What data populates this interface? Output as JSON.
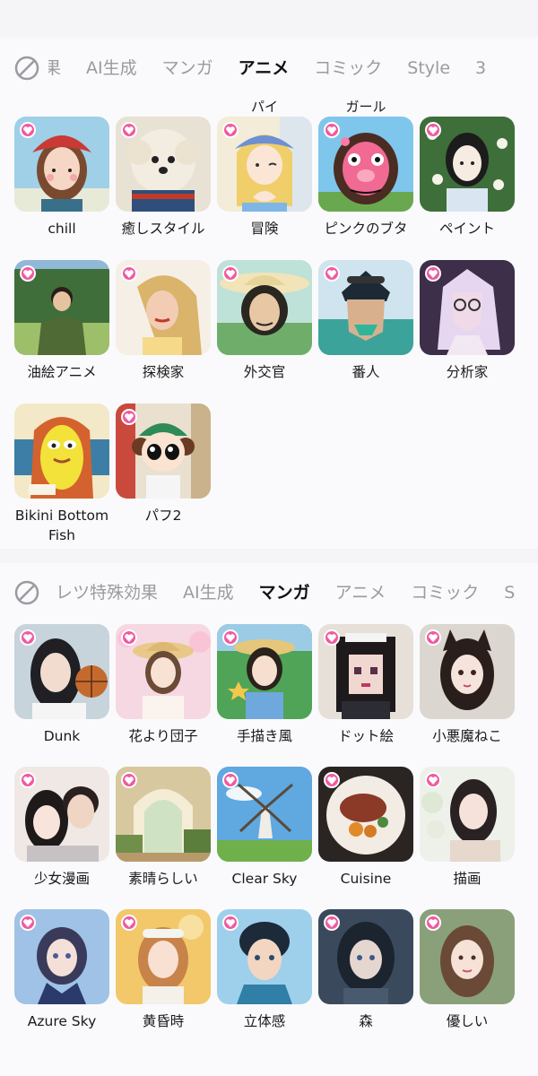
{
  "section1": {
    "tabs": [
      {
        "label": "効果",
        "active": false
      },
      {
        "label": "AI生成",
        "active": false
      },
      {
        "label": "マンガ",
        "active": false
      },
      {
        "label": "アニメ",
        "active": true
      },
      {
        "label": "コミック",
        "active": false
      },
      {
        "label": "Style",
        "active": false
      },
      {
        "label": "3",
        "active": false
      }
    ],
    "overflow_labels": [
      "パイ",
      "ガール"
    ],
    "items": [
      {
        "label": "chill",
        "icon": "girl-red-hat-portrait"
      },
      {
        "label": "癒しスタイル",
        "icon": "fluffy-dog-portrait"
      },
      {
        "label": "冒険",
        "icon": "blonde-girl-heart-hands"
      },
      {
        "label": "ピンクのブタ",
        "icon": "pink-pig-character"
      },
      {
        "label": "ペイント",
        "icon": "girl-flowers-painting"
      },
      {
        "label": "油絵アニメ",
        "icon": "man-forest-oil-painting"
      },
      {
        "label": "探検家",
        "icon": "woman-long-hair-portrait"
      },
      {
        "label": "外交官",
        "icon": "woman-sun-hat-portrait"
      },
      {
        "label": "番人",
        "icon": "man-sunglasses-lowpoly"
      },
      {
        "label": "分析家",
        "icon": "woman-glasses-lowpoly"
      },
      {
        "label": "Bikini Bottom Fish",
        "icon": "yellow-fish-girl-cartoon"
      },
      {
        "label": "パフ2",
        "icon": "puff-girl-cartoon"
      }
    ]
  },
  "section2": {
    "tabs": [
      {
        "label": "レツ特殊効果",
        "active": false
      },
      {
        "label": "AI生成",
        "active": false
      },
      {
        "label": "マンガ",
        "active": true
      },
      {
        "label": "アニメ",
        "active": false
      },
      {
        "label": "コミック",
        "active": false
      },
      {
        "label": "S",
        "active": false
      }
    ],
    "items": [
      {
        "label": "Dunk",
        "icon": "girl-basketball-portrait"
      },
      {
        "label": "花より団子",
        "icon": "girl-straw-hat-blossoms"
      },
      {
        "label": "手描き風",
        "icon": "girl-hat-starfish"
      },
      {
        "label": "ドット絵",
        "icon": "pixel-girl-portrait"
      },
      {
        "label": "小悪魔ねこ",
        "icon": "cat-ear-girl-portrait"
      },
      {
        "label": "少女漫画",
        "icon": "couple-portrait"
      },
      {
        "label": "素晴らしい",
        "icon": "garden-arch-scene"
      },
      {
        "label": "Clear Sky",
        "icon": "windmill-landscape"
      },
      {
        "label": "Cuisine",
        "icon": "steak-dish"
      },
      {
        "label": "描画",
        "icon": "woman-flowers-portrait"
      },
      {
        "label": "Azure Sky",
        "icon": "girl-sailor-uniform"
      },
      {
        "label": "黄昏時",
        "icon": "girl-sunset-portrait"
      },
      {
        "label": "立体感",
        "icon": "boy-3d-portrait"
      },
      {
        "label": "森",
        "icon": "girl-forest-portrait"
      },
      {
        "label": "優しい",
        "icon": "woman-soft-portrait"
      }
    ]
  },
  "colors": {
    "accent_badge": "#f05aa0",
    "active_tab": "#111111",
    "inactive_tab": "#9a9aa1"
  }
}
